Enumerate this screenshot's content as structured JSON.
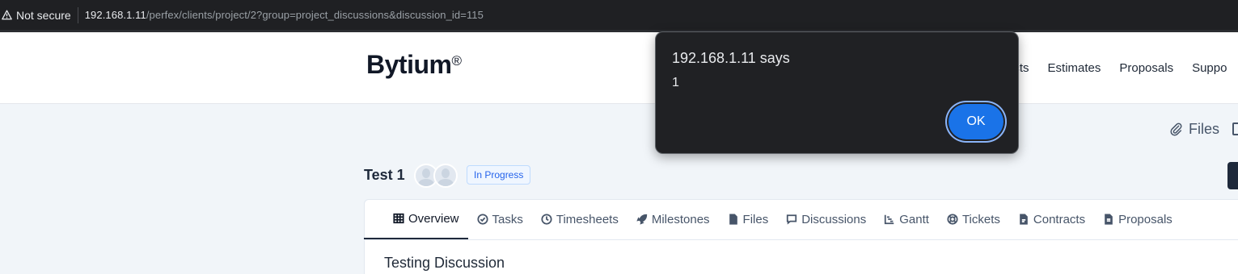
{
  "browser": {
    "security_label": "Not secure",
    "url_host": "192.168.1.11",
    "url_path": "/perfex/clients/project/2?group=project_discussions&discussion_id=115"
  },
  "header": {
    "brand": "Bytium",
    "brand_mark": "®",
    "nav": [
      "acts",
      "Estimates",
      "Proposals",
      "Suppo"
    ]
  },
  "toolbar": {
    "files_label": "Files"
  },
  "project": {
    "title": "Test 1",
    "status": "In Progress"
  },
  "tabs": [
    {
      "label": "Overview",
      "icon": "table-icon",
      "active": true
    },
    {
      "label": "Tasks",
      "icon": "check-circle-icon"
    },
    {
      "label": "Timesheets",
      "icon": "clock-icon"
    },
    {
      "label": "Milestones",
      "icon": "rocket-icon"
    },
    {
      "label": "Files",
      "icon": "file-icon"
    },
    {
      "label": "Discussions",
      "icon": "chat-icon"
    },
    {
      "label": "Gantt",
      "icon": "chart-icon"
    },
    {
      "label": "Tickets",
      "icon": "lifebuoy-icon"
    },
    {
      "label": "Contracts",
      "icon": "contract-icon"
    },
    {
      "label": "Proposals",
      "icon": "document-icon"
    }
  ],
  "discussion": {
    "title": "Testing Discussion"
  },
  "dialog": {
    "title": "192.168.1.11 says",
    "message": "1",
    "ok_label": "OK"
  },
  "colors": {
    "dialog_bg": "#202124",
    "ok_button": "#1a73e8",
    "badge_text": "#2563eb"
  }
}
